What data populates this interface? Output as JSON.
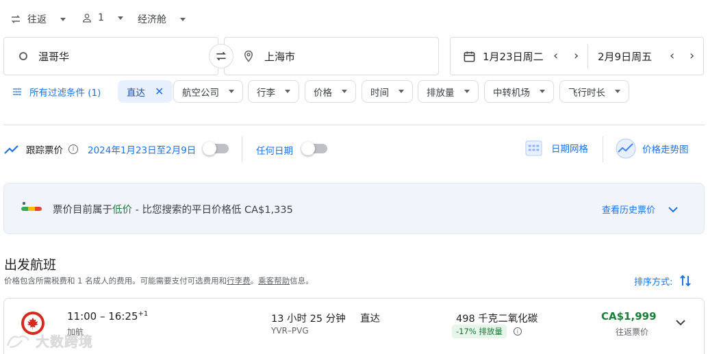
{
  "top_options": {
    "trip_type": "往返",
    "passengers": "1",
    "cabin": "经济舱"
  },
  "search": {
    "origin": "温哥华",
    "destination": "上海市",
    "depart_date": "1月23日周二",
    "return_date": "2月9日周五"
  },
  "filters": {
    "all_filters": "所有过滤条件 (1)",
    "chips": [
      "直达",
      "航空公司",
      "行李",
      "价格",
      "时间",
      "排放量",
      "中转机场",
      "飞行时长"
    ]
  },
  "tracking": {
    "label": "跟踪票价",
    "dates": "2024年1月23日至2月9日",
    "any_dates": "任何日期",
    "date_grid": "日期网格",
    "price_graph": "价格走势图"
  },
  "banner": {
    "prefix": "票价目前属于",
    "level": "低价",
    "suffix": " - 比您搜索的平日价格低 CA$1,335",
    "history_link": "查看历史票价"
  },
  "results": {
    "heading": "出发航班",
    "note_prefix": "价格包含所需税费和 1 名成人的费用。可能需要支付可选费用和",
    "note_link1": "行李费",
    "note_mid": "。",
    "note_link2": "乘客帮助",
    "note_suffix": "信息。",
    "sort_label": "排序方式:"
  },
  "flight": {
    "times": "11:00 – 16:25",
    "day_offset": "+1",
    "airline": "加航",
    "duration": "13 小时 25 分钟",
    "route": "YVR–PVG",
    "stops": "直达",
    "emissions": "498 千克二氧化碳",
    "emissions_badge": "-17% 排放量",
    "price": "CA$1,999",
    "price_type": "往返票价"
  },
  "watermark": "大数跨境",
  "colors": {
    "accent": "#1a73e8",
    "low_price": "#188038",
    "airline_red": "#d52b1e"
  }
}
